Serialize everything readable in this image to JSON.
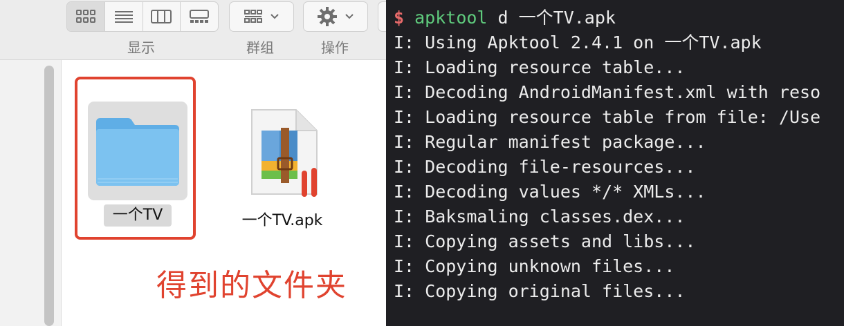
{
  "toolbar": {
    "view_label": "显示",
    "group_label": "群组",
    "action_label": "操作"
  },
  "files": {
    "folder_name": "一个TV",
    "apk_name": "一个TV.apk"
  },
  "annotation": "得到的文件夹",
  "terminal": {
    "prompt": "$",
    "command": "apktool",
    "args": " d 一个TV.apk",
    "output": [
      "I: Using Apktool 2.4.1 on 一个TV.apk",
      "I: Loading resource table...",
      "I: Decoding AndroidManifest.xml with reso",
      "I: Loading resource table from file: /Use",
      "I: Regular manifest package...",
      "I: Decoding file-resources...",
      "I: Decoding values */* XMLs...",
      "I: Baksmaling classes.dex...",
      "I: Copying assets and libs...",
      "I: Copying unknown files...",
      "I: Copying original files..."
    ]
  },
  "colors": {
    "annotation_red": "#e0432f",
    "terminal_bg": "#1f1f23",
    "prompt_red": "#e86a6a",
    "command_green": "#5fcb7d",
    "folder_blue": "#7cc2f0"
  }
}
